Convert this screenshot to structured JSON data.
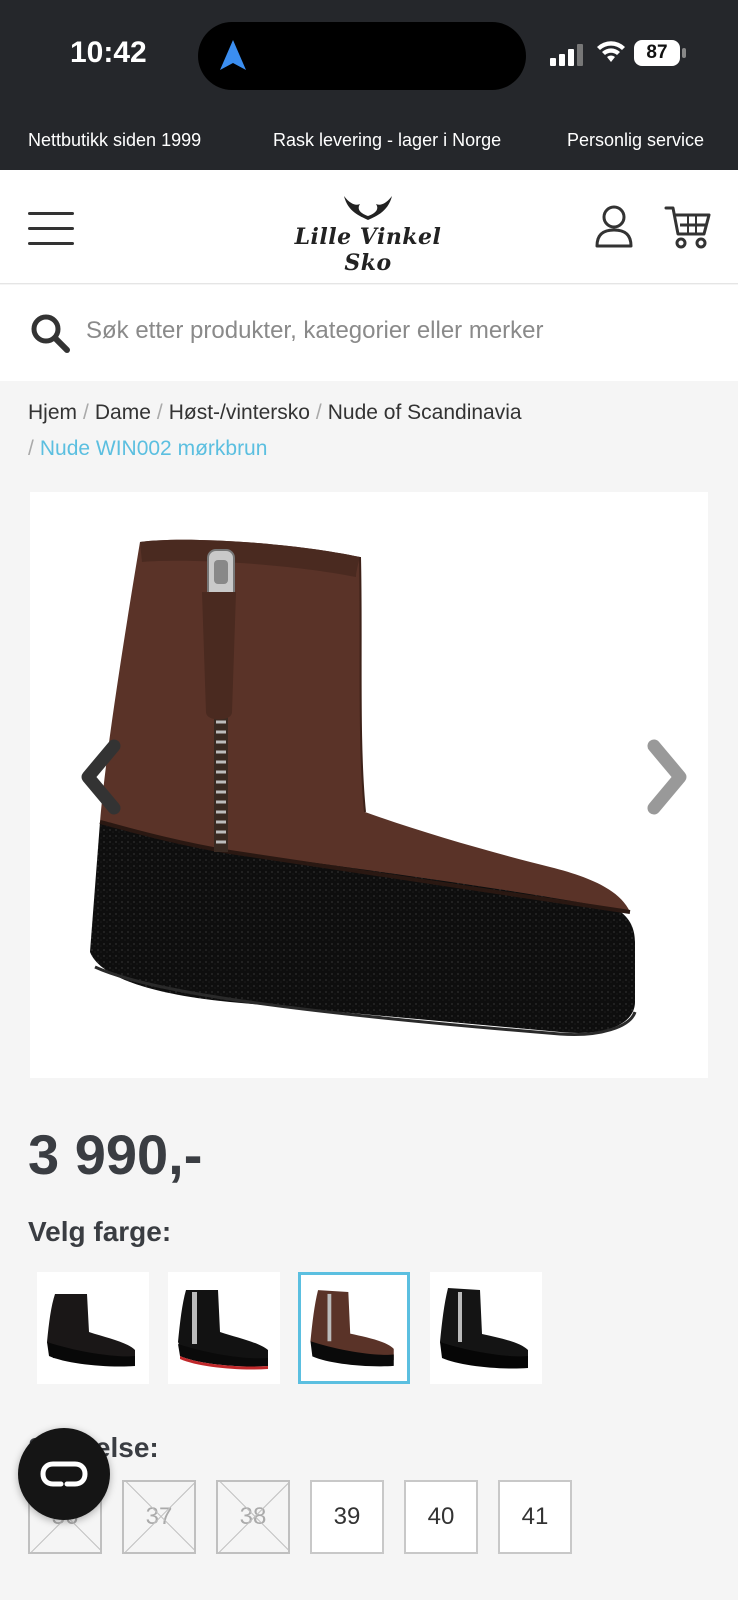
{
  "status_bar": {
    "time": "10:42",
    "battery": "87"
  },
  "promo_bar": {
    "items": [
      "Nettbutikk siden 1999",
      "Rask levering - lager i Norge",
      "Personlig service"
    ]
  },
  "header": {
    "logo_text": "Lille Vinkel Sko"
  },
  "search": {
    "placeholder": "Søk etter produkter, kategorier eller merker"
  },
  "breadcrumb": {
    "items": [
      "Hjem",
      "Dame",
      "Høst-/vintersko",
      "Nude of Scandinavia"
    ],
    "current": "Nude WIN002 mørkbrun"
  },
  "product": {
    "price": "3 990,-",
    "color_label": "Velg farge:",
    "colors": [
      {
        "name": "black-suede",
        "selected": false
      },
      {
        "name": "black-leather-red-sole",
        "selected": false
      },
      {
        "name": "dark-brown",
        "selected": true
      },
      {
        "name": "black-zip",
        "selected": false
      }
    ],
    "size_label": "Størrelse:",
    "sizes": [
      {
        "label": "36",
        "available": false
      },
      {
        "label": "37",
        "available": false
      },
      {
        "label": "38",
        "available": false
      },
      {
        "label": "39",
        "available": true
      },
      {
        "label": "40",
        "available": true
      },
      {
        "label": "41",
        "available": true
      }
    ]
  },
  "colors": {
    "accent": "#5bbfe0",
    "dark_bar": "#25272b",
    "boot_brown": "#5a3328",
    "text_dark": "#3a3d42"
  }
}
